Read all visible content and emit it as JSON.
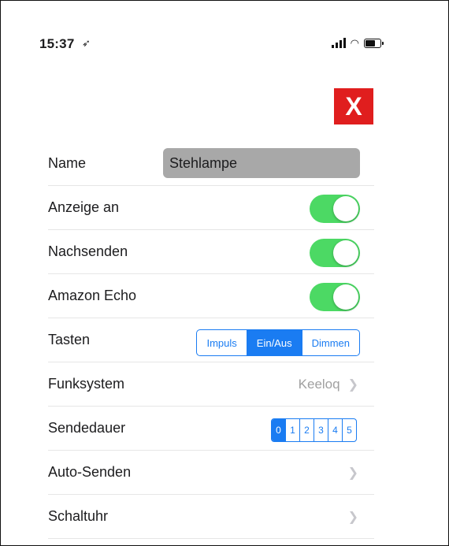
{
  "status_bar": {
    "time": "15:37"
  },
  "close_button": {
    "label": "X",
    "color": "#e01e1e"
  },
  "rows": {
    "name": {
      "label": "Name",
      "value": "Stehlampe"
    },
    "anzeige": {
      "label": "Anzeige an",
      "on": true
    },
    "nachsenden": {
      "label": "Nachsenden",
      "on": true
    },
    "echo": {
      "label": "Amazon Echo",
      "on": true
    },
    "tasten": {
      "label": "Tasten",
      "options": [
        "Impuls",
        "Ein/Aus",
        "Dimmen"
      ],
      "selected": "Ein/Aus"
    },
    "funksystem": {
      "label": "Funksystem",
      "value": "Keeloq"
    },
    "sendedauer": {
      "label": "Sendedauer",
      "options": [
        "0",
        "1",
        "2",
        "3",
        "4",
        "5"
      ],
      "selected": "0"
    },
    "autosenden": {
      "label": "Auto-Senden"
    },
    "schaltuhr": {
      "label": "Schaltuhr"
    }
  },
  "colors": {
    "toggle_on": "#4cd964",
    "accent": "#1a7cf2",
    "field_bg": "#a8a8a8"
  },
  "icons": {
    "chevron": "chevron-right-icon",
    "location": "location-arrow-icon"
  }
}
